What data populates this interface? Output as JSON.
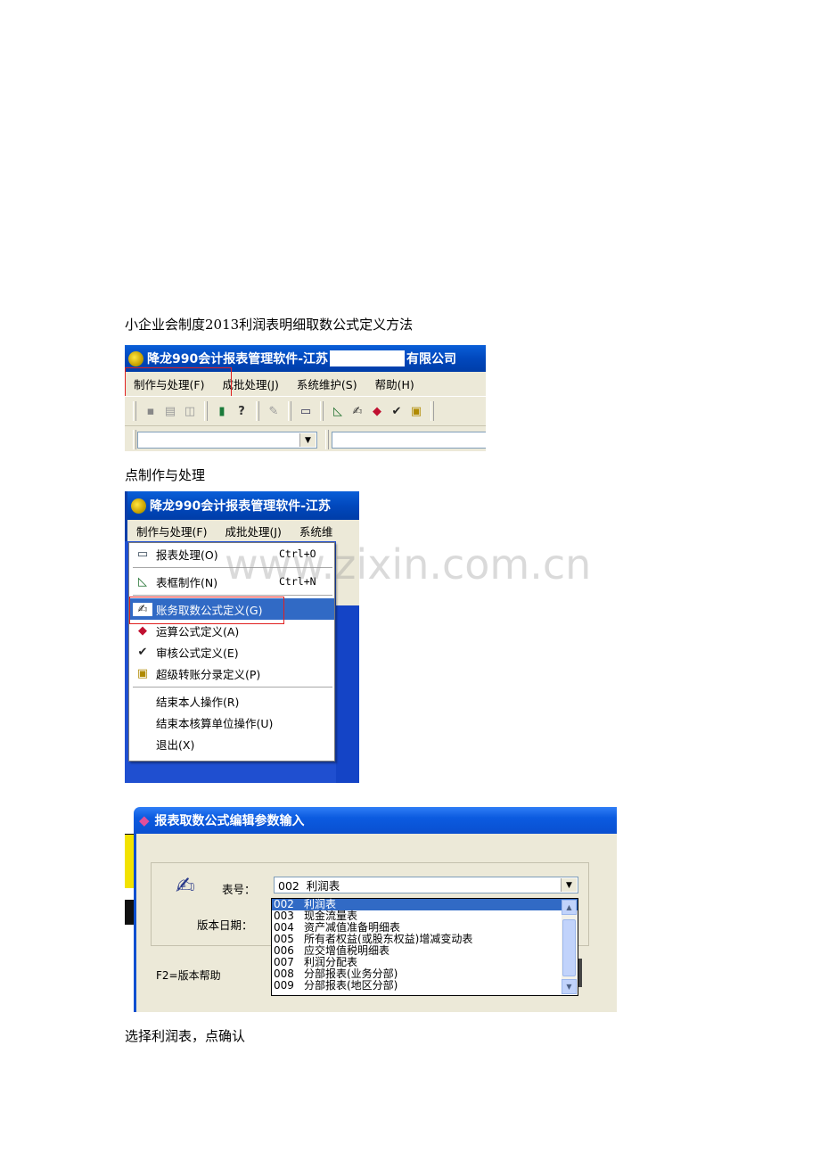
{
  "captions": {
    "intro": "小企业会制度2013利润表明细取数公式定义方法",
    "step1": "点制作与处理",
    "step2": "选择利润表，点确认"
  },
  "watermark": "www.zixin.com.cn",
  "app": {
    "title_prefix": "降龙990会计报表管理软件-江苏",
    "title_suffix": "有限公司",
    "title_short": "降龙990会计报表管理软件-江苏"
  },
  "menubar": {
    "items": [
      "制作与处理(F)",
      "成批处理(J)",
      "系统维护(S)",
      "帮助(H)"
    ],
    "items_short": [
      "制作与处理(F)",
      "成批处理(J)",
      "系统维"
    ]
  },
  "menu": {
    "items": [
      {
        "label": "报表处理(O)",
        "shortcut": "Ctrl+O",
        "icon": "report-icon"
      },
      {
        "label": "表框制作(N)",
        "shortcut": "Ctrl+N",
        "icon": "chart-icon"
      },
      {
        "label": "账务取数公式定义(G)",
        "shortcut": "",
        "icon": "formula-icon"
      },
      {
        "label": "运算公式定义(A)",
        "shortcut": "",
        "icon": "calc-icon"
      },
      {
        "label": "审核公式定义(E)",
        "shortcut": "",
        "icon": "check-icon"
      },
      {
        "label": "超级转账分录定义(P)",
        "shortcut": "",
        "icon": "transfer-icon"
      },
      {
        "label": "结束本人操作(R)",
        "shortcut": "",
        "icon": ""
      },
      {
        "label": "结束本核算单位操作(U)",
        "shortcut": "",
        "icon": ""
      },
      {
        "label": "退出(X)",
        "shortcut": "",
        "icon": ""
      }
    ]
  },
  "dialog": {
    "title": "报表取数公式编辑参数输入",
    "table_label": "表号：",
    "table_value": "002  利润表",
    "version_label": "版本日期：",
    "help_text": "F2=版本帮助",
    "options": [
      {
        "code": "002",
        "name": "利润表"
      },
      {
        "code": "003",
        "name": "现金流量表"
      },
      {
        "code": "004",
        "name": "资产减值准备明细表"
      },
      {
        "code": "005",
        "name": "所有者权益(或股东权益)增减变动表"
      },
      {
        "code": "006",
        "name": "应交增值税明细表"
      },
      {
        "code": "007",
        "name": "利润分配表"
      },
      {
        "code": "008",
        "name": "分部报表(业务分部)"
      },
      {
        "code": "009",
        "name": "分部报表(地区分部)"
      }
    ],
    "selected_index": 0
  },
  "colors": {
    "titlebar": "#0148bd",
    "highlight": "#316ac5",
    "menubar": "#ece9d8",
    "annotation": "#e02020"
  }
}
